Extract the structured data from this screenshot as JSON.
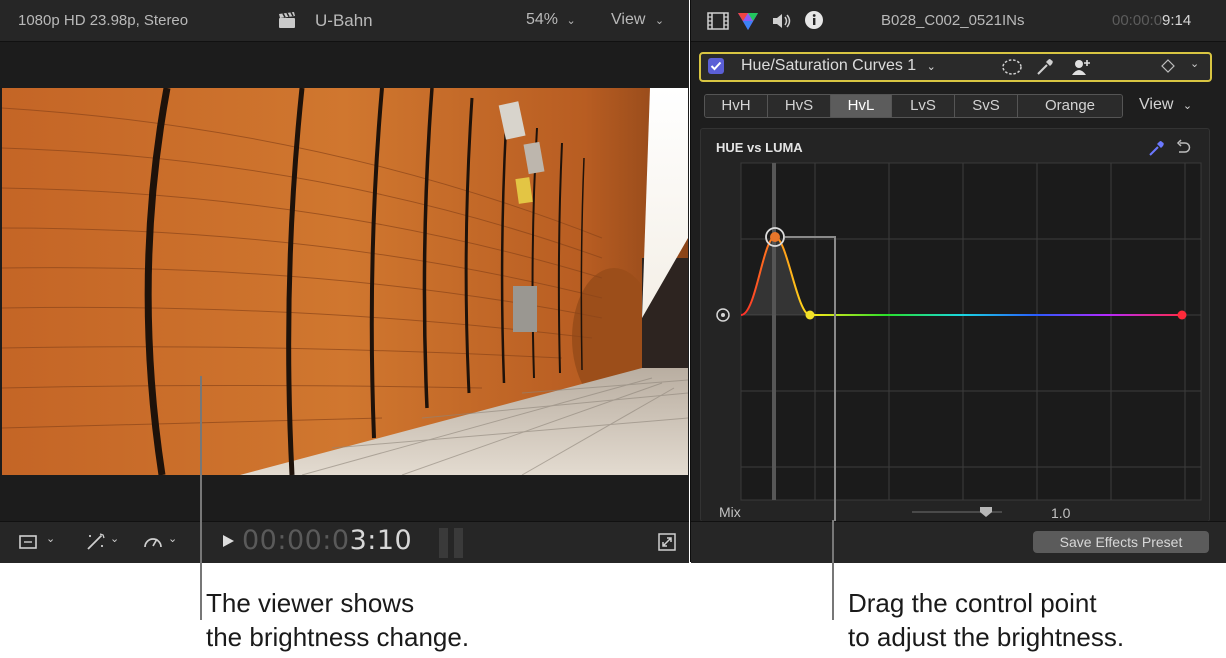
{
  "viewer": {
    "format": "1080p HD 23.98p, Stereo",
    "clip_title": "U-Bahn",
    "zoom": "54%",
    "view_menu": "View",
    "timecode_dim": "00:00:0",
    "timecode_bright": "3:10"
  },
  "inspector": {
    "clip_name": "B028_C002_0521INs",
    "timecode_dim": "00:00:0",
    "timecode_bright": "9:14",
    "effect_name": "Hue/Saturation Curves 1",
    "effect_enabled": true,
    "tabs": [
      {
        "label": "HvH",
        "active": false
      },
      {
        "label": "HvS",
        "active": false
      },
      {
        "label": "HvL",
        "active": true
      },
      {
        "label": "LvS",
        "active": false
      },
      {
        "label": "SvS",
        "active": false
      },
      {
        "label": "Orange",
        "active": false
      }
    ],
    "view_menu": "View",
    "graph_title": "HUE vs LUMA",
    "mix_label": "Mix",
    "mix_value": "1.0",
    "mix_level": 1.0,
    "save_button": "Save Effects Preset"
  },
  "callouts": {
    "left_line1": "The viewer shows",
    "left_line2": "the brightness change.",
    "right_line1": "Drag the control point",
    "right_line2": "to adjust the brightness."
  },
  "colors": {
    "highlight_border": "#d8c542",
    "checkbox": "#5b5fd6",
    "control_point": "#e8762a",
    "tile_wall": "#c9692a"
  },
  "icons": [
    "clapper-icon",
    "film-icon",
    "color-icon",
    "audio-icon",
    "info-icon",
    "mask-ellipse-icon",
    "eyedropper-icon",
    "add-shape-icon",
    "keyframe-icon",
    "transform-icon",
    "enhance-icon",
    "speed-icon",
    "play-icon",
    "fullscreen-icon",
    "reset-icon"
  ]
}
